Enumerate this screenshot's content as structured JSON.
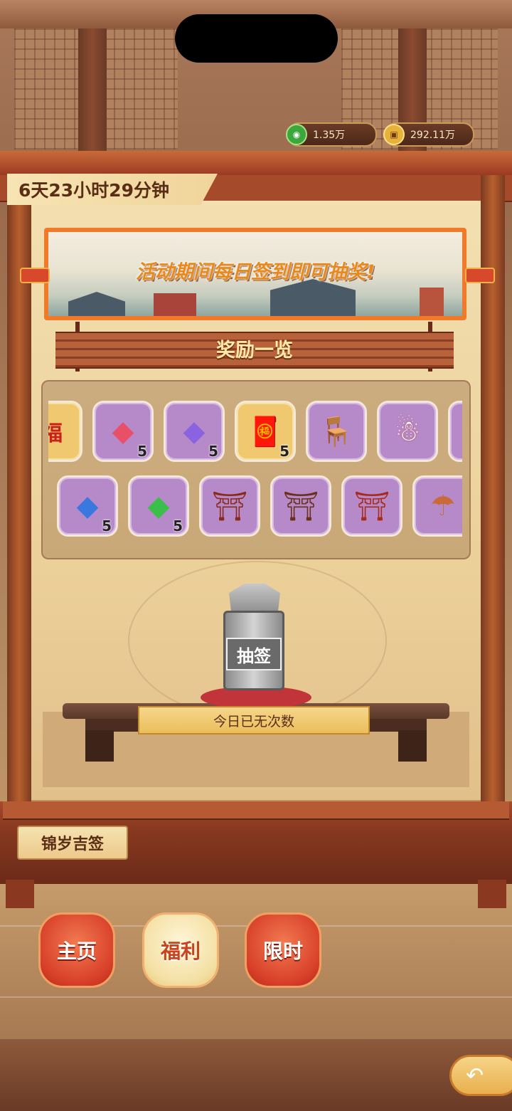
{
  "currency": {
    "jade": {
      "icon": "jade-coin-icon",
      "value": "1.35万"
    },
    "gold": {
      "icon": "copper-coin-icon",
      "value": "292.11万"
    }
  },
  "event": {
    "timer": "6天23小时29分钟",
    "banner_text": "活动期间每日签到即可抽奖!",
    "rewards_title": "奖励一览",
    "draw_label": "抽签",
    "status_text": "今日已无次数",
    "activity_name": "锦岁吉签"
  },
  "rewards": {
    "row1": [
      {
        "icon": "fu-red-envelope-icon",
        "glyph": "福",
        "qty": ""
      },
      {
        "icon": "red-crystal-icon",
        "glyph": "◆",
        "qty": "5"
      },
      {
        "icon": "purple-crystal-icon",
        "glyph": "◆",
        "qty": "5"
      },
      {
        "icon": "dragon-scroll-icon",
        "glyph": "🧧",
        "qty": "5"
      },
      {
        "icon": "wooden-chair-icon",
        "glyph": "🪑",
        "qty": ""
      },
      {
        "icon": "snowman-icon",
        "glyph": "☃",
        "qty": ""
      },
      {
        "icon": "partial-item-icon",
        "glyph": "",
        "qty": ""
      }
    ],
    "row2": [
      {
        "icon": "partial-item-icon",
        "glyph": "",
        "qty": ""
      },
      {
        "icon": "blue-crystal-icon",
        "glyph": "◆",
        "qty": "5"
      },
      {
        "icon": "green-crystal-icon",
        "glyph": "◆",
        "qty": "5"
      },
      {
        "icon": "market-stall-icon",
        "glyph": "⛩",
        "qty": ""
      },
      {
        "icon": "pavilion-stall-icon",
        "glyph": "⛩",
        "qty": ""
      },
      {
        "icon": "red-pavilion-icon",
        "glyph": "⛩",
        "qty": ""
      },
      {
        "icon": "umbrella-stall-icon",
        "glyph": "☂",
        "qty": ""
      }
    ]
  },
  "nav": {
    "home": "主页",
    "welfare": "福利",
    "limited": "限时"
  },
  "colors": {
    "crystal_red": "#e8506a",
    "crystal_purple": "#8a64e0",
    "crystal_blue": "#3a78e0",
    "crystal_green": "#3cbf4a",
    "tile_purple": "#b68ac8",
    "tile_gold": "#f0c870"
  }
}
